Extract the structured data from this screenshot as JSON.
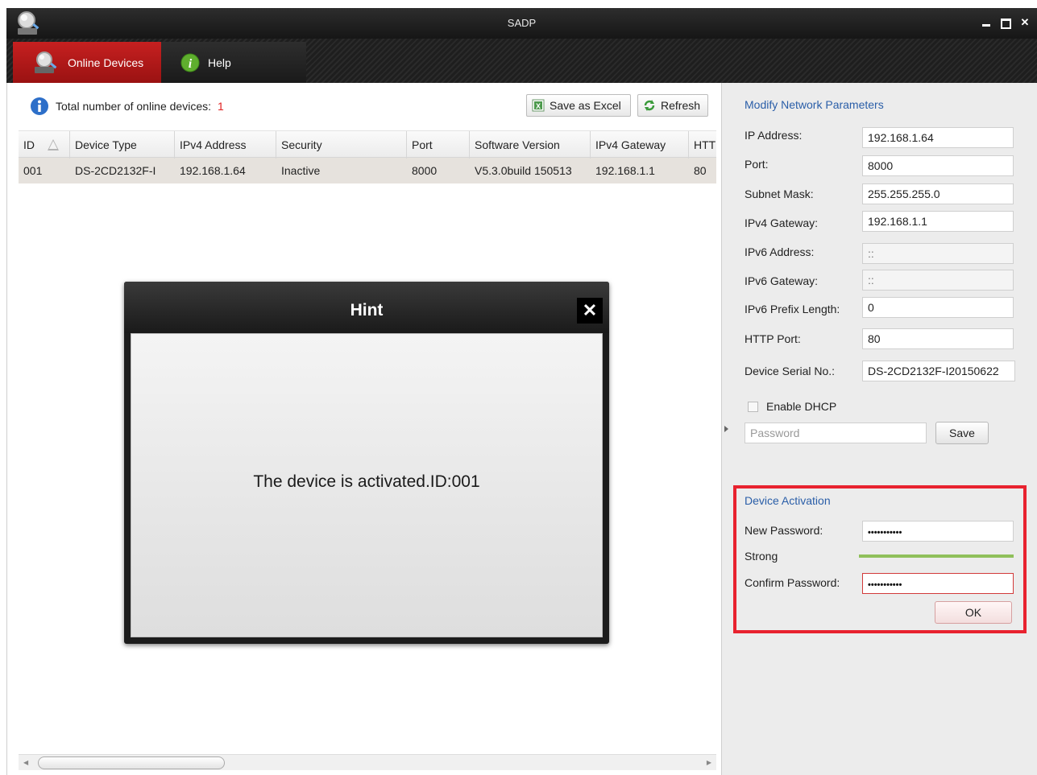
{
  "window": {
    "title": "SADP",
    "controls": {
      "minimize": "_",
      "maximize": "□",
      "close": "✕"
    }
  },
  "tabs": [
    {
      "label": "Online Devices",
      "icon": "magnifier-device-icon",
      "active": true
    },
    {
      "label": "Help",
      "icon": "info-green-icon",
      "active": false
    }
  ],
  "summary": {
    "label": "Total number of online devices:",
    "count": "1"
  },
  "toolbar": {
    "save_excel": "Save as Excel",
    "refresh": "Refresh"
  },
  "table": {
    "columns": [
      "ID",
      "Device Type",
      "IPv4 Address",
      "Security",
      "Port",
      "Software Version",
      "IPv4 Gateway",
      "HTT"
    ],
    "rows": [
      {
        "id": "001",
        "device_type": "DS-2CD2132F-I",
        "ipv4": "192.168.1.64",
        "security": "Inactive",
        "port": "8000",
        "software": "V5.3.0build 150513",
        "gateway": "192.168.1.1",
        "http": "80"
      }
    ]
  },
  "modal": {
    "title": "Hint",
    "close": "✕",
    "message": "The device is activated.ID:001"
  },
  "network": {
    "section_title": "Modify Network Parameters",
    "ip_label": "IP Address:",
    "ip_value": "192.168.1.64",
    "port_label": "Port:",
    "port_value": "8000",
    "subnet_label": "Subnet Mask:",
    "subnet_value": "255.255.255.0",
    "gateway_label": "IPv4 Gateway:",
    "gateway_value": "192.168.1.1",
    "ipv6_label": "IPv6 Address:",
    "ipv6_value": "::",
    "ipv6_gw_label": "IPv6 Gateway:",
    "ipv6_gw_value": "::",
    "prefix_label": "IPv6 Prefix Length:",
    "prefix_value": "0",
    "http_label": "HTTP Port:",
    "http_value": "80",
    "serial_label": "Device Serial No.:",
    "serial_value": "DS-2CD2132F-I20150622",
    "dhcp_label": "Enable DHCP",
    "password_placeholder": "Password",
    "save_label": "Save"
  },
  "activation": {
    "section_title": "Device Activation",
    "new_password_label": "New Password:",
    "new_password_value": "•••••••••••",
    "strength_label": "Strong",
    "confirm_label": "Confirm Password:",
    "confirm_value": "•••••••••••",
    "ok_label": "OK",
    "colors": {
      "highlight_border": "#e8222f",
      "strength_bar": "#8fc05a"
    }
  }
}
